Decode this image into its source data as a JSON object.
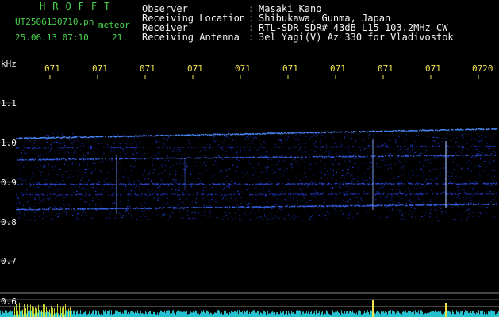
{
  "header": {
    "brand": "HROFFT",
    "filename": "UT2506130710.pn",
    "tag": "meteor",
    "datetime": "25.06.13 07:10",
    "datetime_num": "21.",
    "meta": [
      {
        "label": "Observer",
        "value": "Masaki Kano"
      },
      {
        "label": "Receiving Location",
        "value": "Shibukawa, Gunma, Japan"
      },
      {
        "label": "Receiver",
        "value": "RTL-SDR SDR# 43dB L15 103.2MHz CW"
      },
      {
        "label": "Receiving Antenna",
        "value": "3el Yagi(V) Az 330 for Vladivostok"
      }
    ]
  },
  "axes": {
    "y_unit": "kHz",
    "y_ticks": [
      "1.1",
      "1.0",
      "0.9",
      "0.8",
      "0.7",
      "0.6"
    ],
    "x_ticks": [
      "071",
      "071",
      "071",
      "071",
      "071",
      "071",
      "071",
      "071",
      "071",
      "0720"
    ]
  },
  "colors": {
    "label_green": "#49d34d",
    "text_white": "#f2f2f2",
    "tick_yellow": "#f0e24a",
    "signal_blue": "#2a3cff",
    "noise_cyan": "#2ad6e6"
  }
}
